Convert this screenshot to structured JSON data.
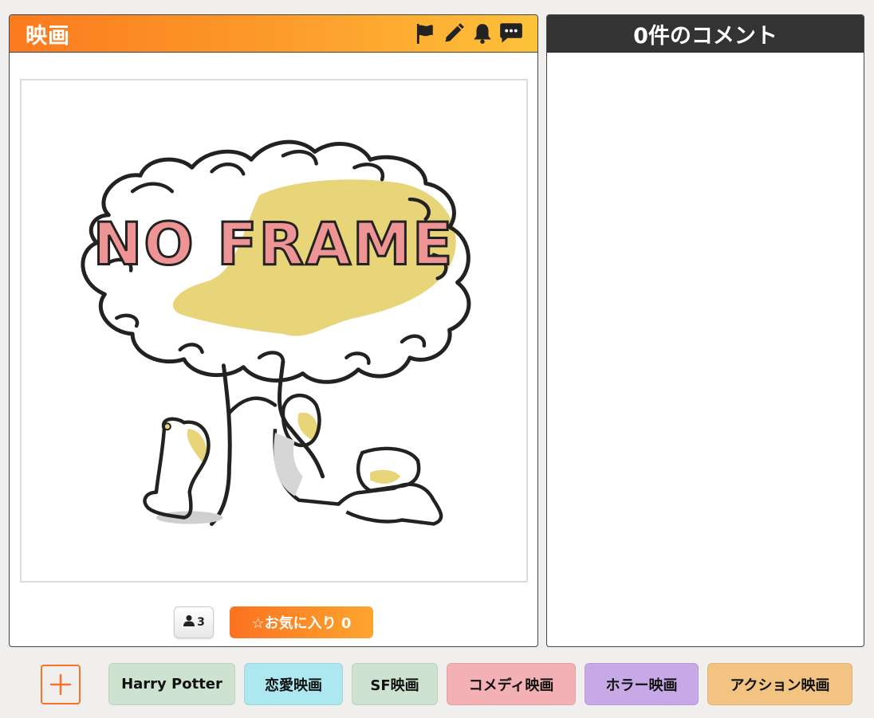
{
  "left_panel": {
    "title": "映画",
    "header_icons": [
      "flag-icon",
      "pencil-icon",
      "bell-icon",
      "comment-icon"
    ],
    "image": {
      "placeholder_text": "NO FRAME"
    },
    "member_count": "3",
    "favorite_label": "☆お気に入り 0"
  },
  "right_panel": {
    "title": "0件のコメント"
  },
  "tags": [
    {
      "label": "Harry Potter",
      "color": "#cde3cf"
    },
    {
      "label": "恋愛映画",
      "color": "#ade8f0"
    },
    {
      "label": "SF映画",
      "color": "#cde3cf"
    },
    {
      "label": "コメディ映画",
      "color": "#f3b0b5"
    },
    {
      "label": "ホラー映画",
      "color": "#c7a9e8"
    },
    {
      "label": "アクション映画",
      "color": "#f2c381"
    }
  ],
  "colors": {
    "accent": "#fb7a1e",
    "dark_header": "#333333",
    "background": "#f0efee"
  }
}
